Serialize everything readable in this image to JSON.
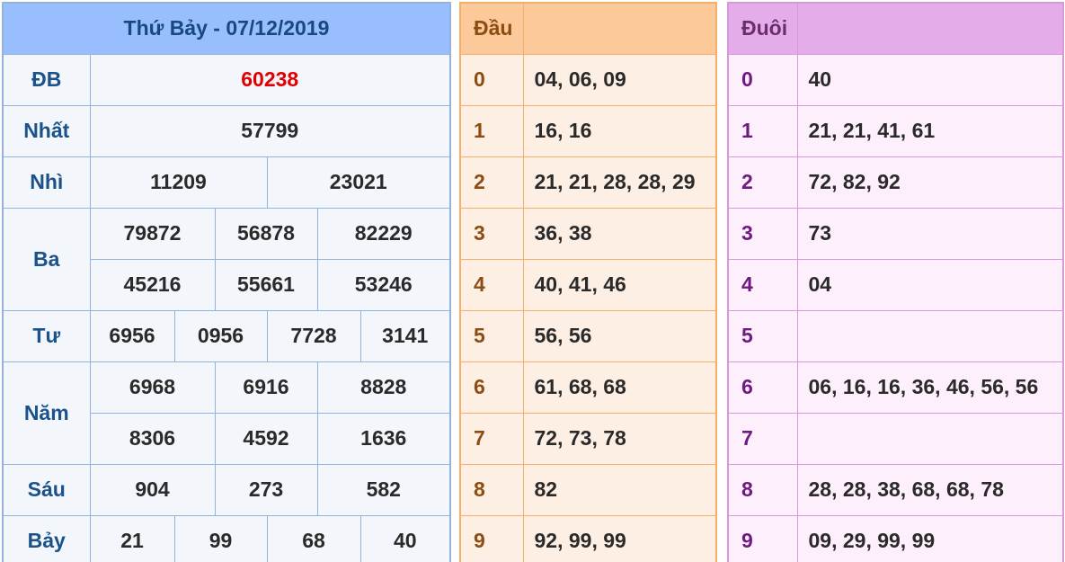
{
  "results": {
    "title": "Thứ Bảy - 07/12/2019",
    "db_label": "ĐB",
    "db": "60238",
    "nhat_label": "Nhất",
    "nhat": "57799",
    "nhi_label": "Nhì",
    "nhi": [
      "11209",
      "23021"
    ],
    "ba_label": "Ba",
    "ba": [
      "79872",
      "56878",
      "82229",
      "45216",
      "55661",
      "53246"
    ],
    "tu_label": "Tư",
    "tu": [
      "6956",
      "0956",
      "7728",
      "3141"
    ],
    "nam_label": "Năm",
    "nam": [
      "6968",
      "6916",
      "8828",
      "8306",
      "4592",
      "1636"
    ],
    "sau_label": "Sáu",
    "sau": [
      "904",
      "273",
      "582"
    ],
    "bay_label": "Bảy",
    "bay": [
      "21",
      "99",
      "68",
      "40"
    ]
  },
  "dau": {
    "header": "Đầu",
    "rows": [
      {
        "k": "0",
        "v": "04, 06, 09"
      },
      {
        "k": "1",
        "v": "16, 16"
      },
      {
        "k": "2",
        "v": "21, 21, 28, 28, 29"
      },
      {
        "k": "3",
        "v": "36, 38"
      },
      {
        "k": "4",
        "v": "40, 41, 46"
      },
      {
        "k": "5",
        "v": "56, 56"
      },
      {
        "k": "6",
        "v": "61, 68, 68"
      },
      {
        "k": "7",
        "v": "72, 73, 78"
      },
      {
        "k": "8",
        "v": "82"
      },
      {
        "k": "9",
        "v": "92, 99, 99"
      }
    ]
  },
  "duoi": {
    "header": "Đuôi",
    "rows": [
      {
        "k": "0",
        "v": "40"
      },
      {
        "k": "1",
        "v": "21, 21, 41, 61"
      },
      {
        "k": "2",
        "v": "72, 82, 92"
      },
      {
        "k": "3",
        "v": "73"
      },
      {
        "k": "4",
        "v": "04"
      },
      {
        "k": "5",
        "v": ""
      },
      {
        "k": "6",
        "v": "06, 16, 16, 36, 46, 56, 56"
      },
      {
        "k": "7",
        "v": ""
      },
      {
        "k": "8",
        "v": "28, 28, 38, 68, 68, 78"
      },
      {
        "k": "9",
        "v": "09, 29, 99, 99"
      }
    ]
  }
}
